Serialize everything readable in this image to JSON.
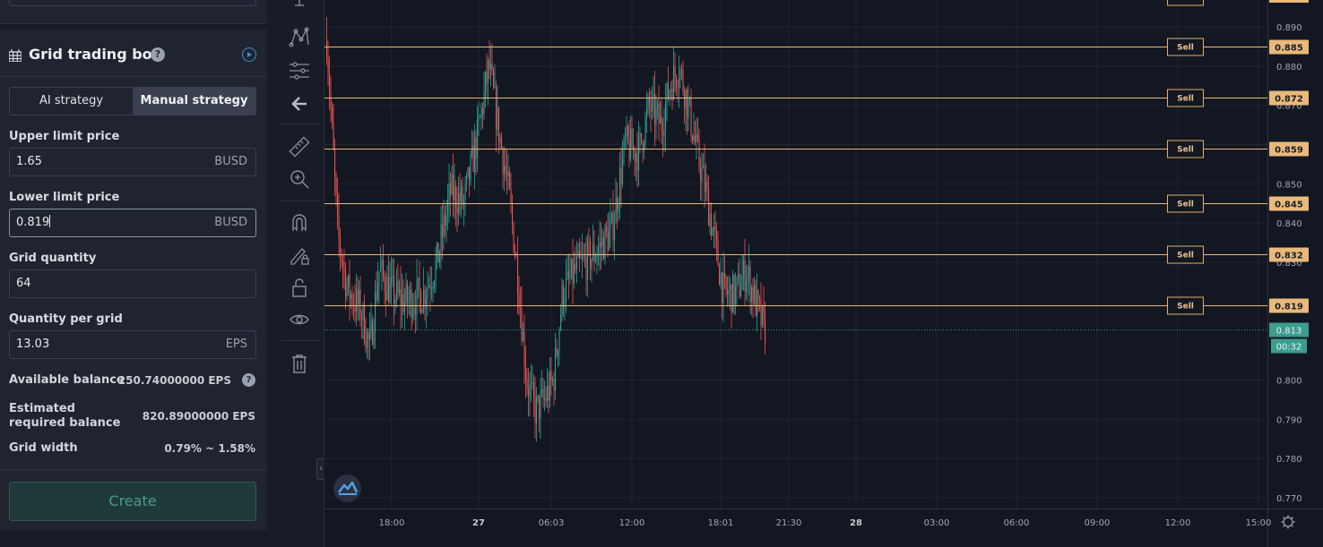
{
  "bot": {
    "title": "Grid trading bot",
    "help_glyph": "?",
    "tabs": [
      {
        "label": "AI strategy",
        "active": false
      },
      {
        "label": "Manual strategy",
        "active": true
      }
    ],
    "fields": {
      "upper": {
        "label": "Upper limit price",
        "value": "1.65",
        "unit": "BUSD"
      },
      "lower": {
        "label": "Lower limit price",
        "value": "0.819",
        "unit": "BUSD"
      },
      "quantity": {
        "label": "Grid quantity",
        "value": "64"
      },
      "per_grid": {
        "label": "Quantity per grid",
        "value": "13.03",
        "unit": "EPS"
      }
    },
    "info": {
      "available_label": "Available balance",
      "available_value": "250.74000000 EPS",
      "required_label": "Estimated required balance",
      "required_value": "820.89000000 EPS",
      "width_label": "Grid width",
      "width_value": "0.79% ~ 1.58%"
    },
    "create_label": "Create"
  },
  "toolbar": {
    "items": [
      "trend-line-icon",
      "pattern-icon",
      "fib-retracement-icon",
      "back-arrow-icon",
      "ruler-icon",
      "zoom-in-icon",
      "magnet-icon",
      "lock-drawing-icon",
      "unlock-icon",
      "eye-icon",
      "trash-icon"
    ]
  },
  "chart_data": {
    "type": "candlestick",
    "price_axis": {
      "ticks": [
        "0.890",
        "0.880",
        "0.870",
        "0.860",
        "0.850",
        "0.840",
        "0.830",
        "0.800",
        "0.790",
        "0.780",
        "0.770"
      ],
      "range": [
        0.768,
        0.895
      ]
    },
    "time_axis": {
      "ticks": [
        "18:00",
        "27",
        "06:03",
        "12:00",
        "18:01",
        "21:30",
        "28",
        "03:00",
        "06:00",
        "09:00",
        "12:00",
        "15:00"
      ]
    },
    "grid_lines": [
      {
        "price": 0.885,
        "label": "0.885",
        "side": "Sell"
      },
      {
        "price": 0.872,
        "label": "0.872",
        "side": "Sell"
      },
      {
        "price": 0.859,
        "label": "0.859",
        "side": "Sell"
      },
      {
        "price": 0.845,
        "label": "0.845",
        "side": "Sell"
      },
      {
        "price": 0.832,
        "label": "0.832",
        "side": "Sell"
      },
      {
        "price": 0.819,
        "label": "0.819",
        "side": "Sell"
      }
    ],
    "current_price": {
      "price": 0.813,
      "label": "0.813",
      "countdown": "00:32"
    },
    "colors": {
      "up": "#26a69a",
      "down": "#ef5350",
      "grid_line": "#e8b97a",
      "current": "#3c9c8f"
    }
  }
}
